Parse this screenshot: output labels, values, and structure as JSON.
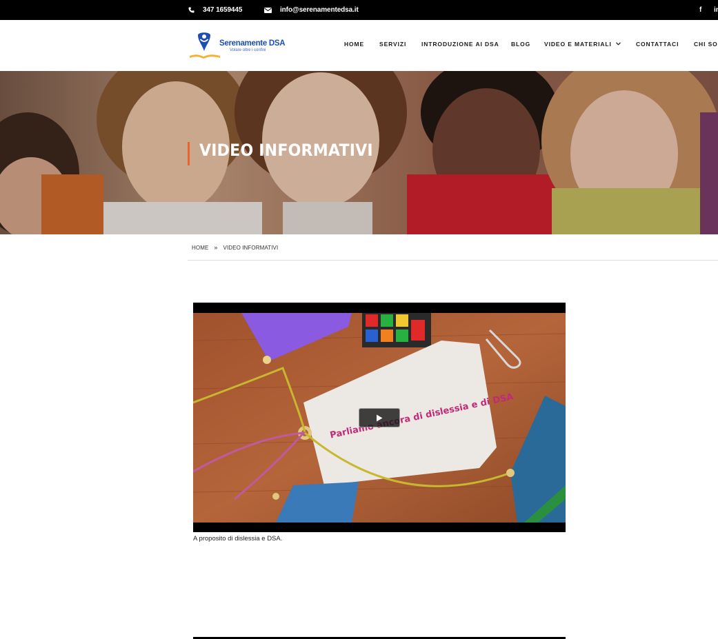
{
  "topbar": {
    "phone": "347 1659445",
    "email": "info@serenamentedsa.it",
    "social": [
      "f",
      "in"
    ]
  },
  "logo": {
    "name": "Serenamente DSA",
    "tagline": "Volare oltre i confini"
  },
  "nav": {
    "items": [
      {
        "label": "HOME"
      },
      {
        "label": "SERVIZI"
      },
      {
        "label": "INTRODUZIONE AI DSA"
      },
      {
        "label": "BLOG"
      },
      {
        "label": "VIDEO E MATERIALI"
      },
      {
        "label": "CONTATTACI"
      },
      {
        "label": "CHI SO"
      }
    ]
  },
  "hero": {
    "title": "VIDEO INFORMATIVI"
  },
  "breadcrumb": {
    "home": "HOME",
    "separator": "»",
    "current": "VIDEO INFORMATIVI"
  },
  "video": {
    "tag_text": "Parliamo ancora di dislessia e di DSA",
    "caption": "A proposito di dislessia e DSA."
  },
  "colors": {
    "accent": "#e8642c",
    "brand": "#1e4fb0",
    "topbar": "#000000"
  }
}
